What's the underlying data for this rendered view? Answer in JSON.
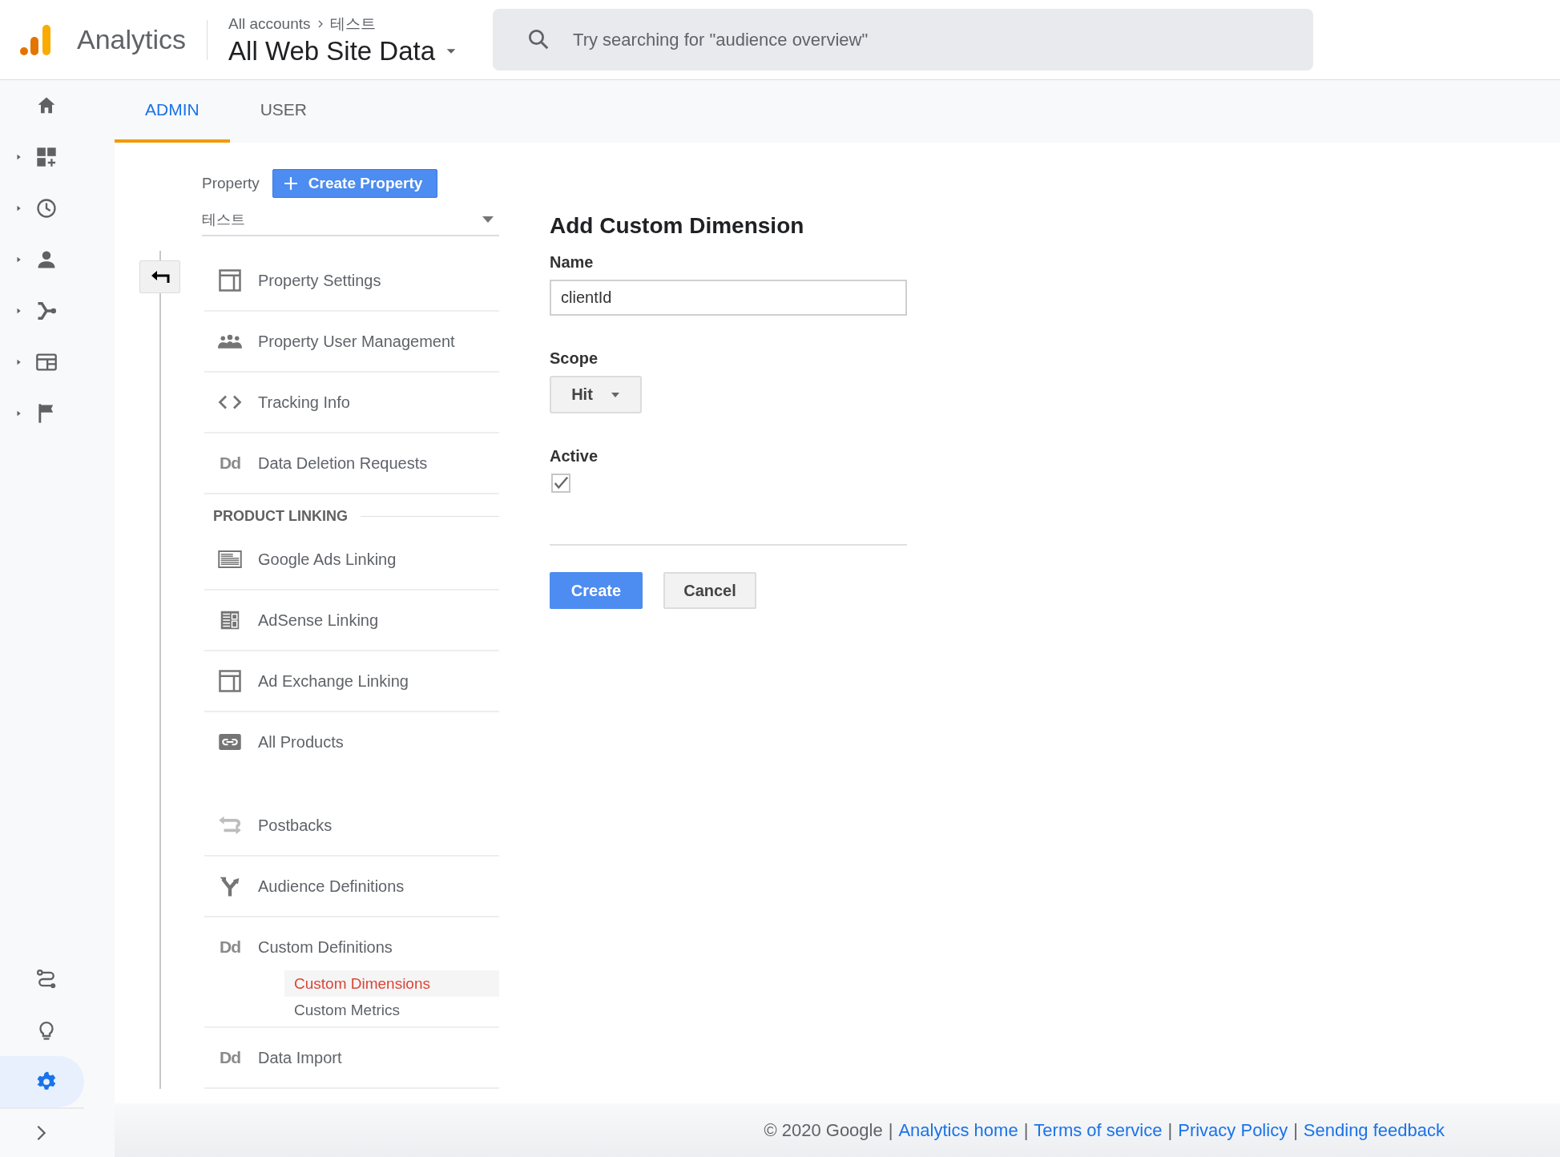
{
  "header": {
    "product": "Analytics",
    "breadcrumb": [
      "All accounts",
      "테스트"
    ],
    "view": "All Web Site Data",
    "search": {
      "placeholder": "Try searching for \"audience overview\""
    }
  },
  "sidebar": {
    "nav_items": [
      {
        "selected": false
      },
      {
        "expanded": false,
        "selected": false
      },
      {
        "expanded": false,
        "selected": false
      },
      {
        "expanded": false,
        "selected": false
      },
      {
        "expanded": false,
        "selected": false
      },
      {
        "expanded": false,
        "selected": false
      },
      {
        "expanded": false,
        "selected": false
      }
    ],
    "bottom_items": [
      {
        "selected": false
      },
      {
        "selected": false
      },
      {
        "selected": true
      }
    ]
  },
  "tabs": [
    {
      "label": "ADMIN",
      "selected": true
    },
    {
      "label": "USER",
      "selected": false
    }
  ],
  "property": {
    "label": "Property",
    "create_button": "Create Property",
    "value": "테스트"
  },
  "menu": {
    "sections": [
      {
        "items": [
          {
            "label": "Property Settings"
          },
          {
            "label": "Property User Management"
          },
          {
            "label": "Tracking Info"
          },
          {
            "label": "Data Deletion Requests",
            "icon_text": "Dd"
          }
        ]
      },
      {
        "heading": "PRODUCT LINKING",
        "items": [
          {
            "label": "Google Ads Linking"
          },
          {
            "label": "AdSense Linking"
          },
          {
            "label": "Ad Exchange Linking"
          },
          {
            "label": "All Products"
          }
        ]
      },
      {
        "items": [
          {
            "label": "Postbacks"
          },
          {
            "label": "Audience Definitions"
          },
          {
            "label": "Custom Definitions",
            "icon_text": "Dd",
            "children": [
              {
                "label": "Custom Dimensions",
                "selected": true
              },
              {
                "label": "Custom Metrics",
                "selected": false
              }
            ]
          },
          {
            "label": "Data Import",
            "icon_text": "Dd"
          }
        ]
      }
    ]
  },
  "form": {
    "title": "Add Custom Dimension",
    "fields": [
      {
        "kind": "text",
        "label": "Name",
        "value": "clientId"
      },
      {
        "kind": "select",
        "label": "Scope",
        "value": "Hit"
      },
      {
        "kind": "checkbox",
        "label": "Active",
        "checked": true
      }
    ],
    "buttons": [
      {
        "kind": "primary",
        "label": "Create"
      },
      {
        "kind": "secondary",
        "label": "Cancel"
      }
    ]
  },
  "footer": {
    "items": [
      {
        "kind": "text",
        "text": "© 2020 Google"
      },
      {
        "kind": "separator",
        "text": "|"
      },
      {
        "kind": "link",
        "text": "Analytics home"
      },
      {
        "kind": "separator",
        "text": "|"
      },
      {
        "kind": "link",
        "text": "Terms of service"
      },
      {
        "kind": "separator",
        "text": "|"
      },
      {
        "kind": "link",
        "text": "Privacy Policy"
      },
      {
        "kind": "separator",
        "text": "|"
      },
      {
        "kind": "link",
        "text": "Sending feedback"
      }
    ]
  }
}
